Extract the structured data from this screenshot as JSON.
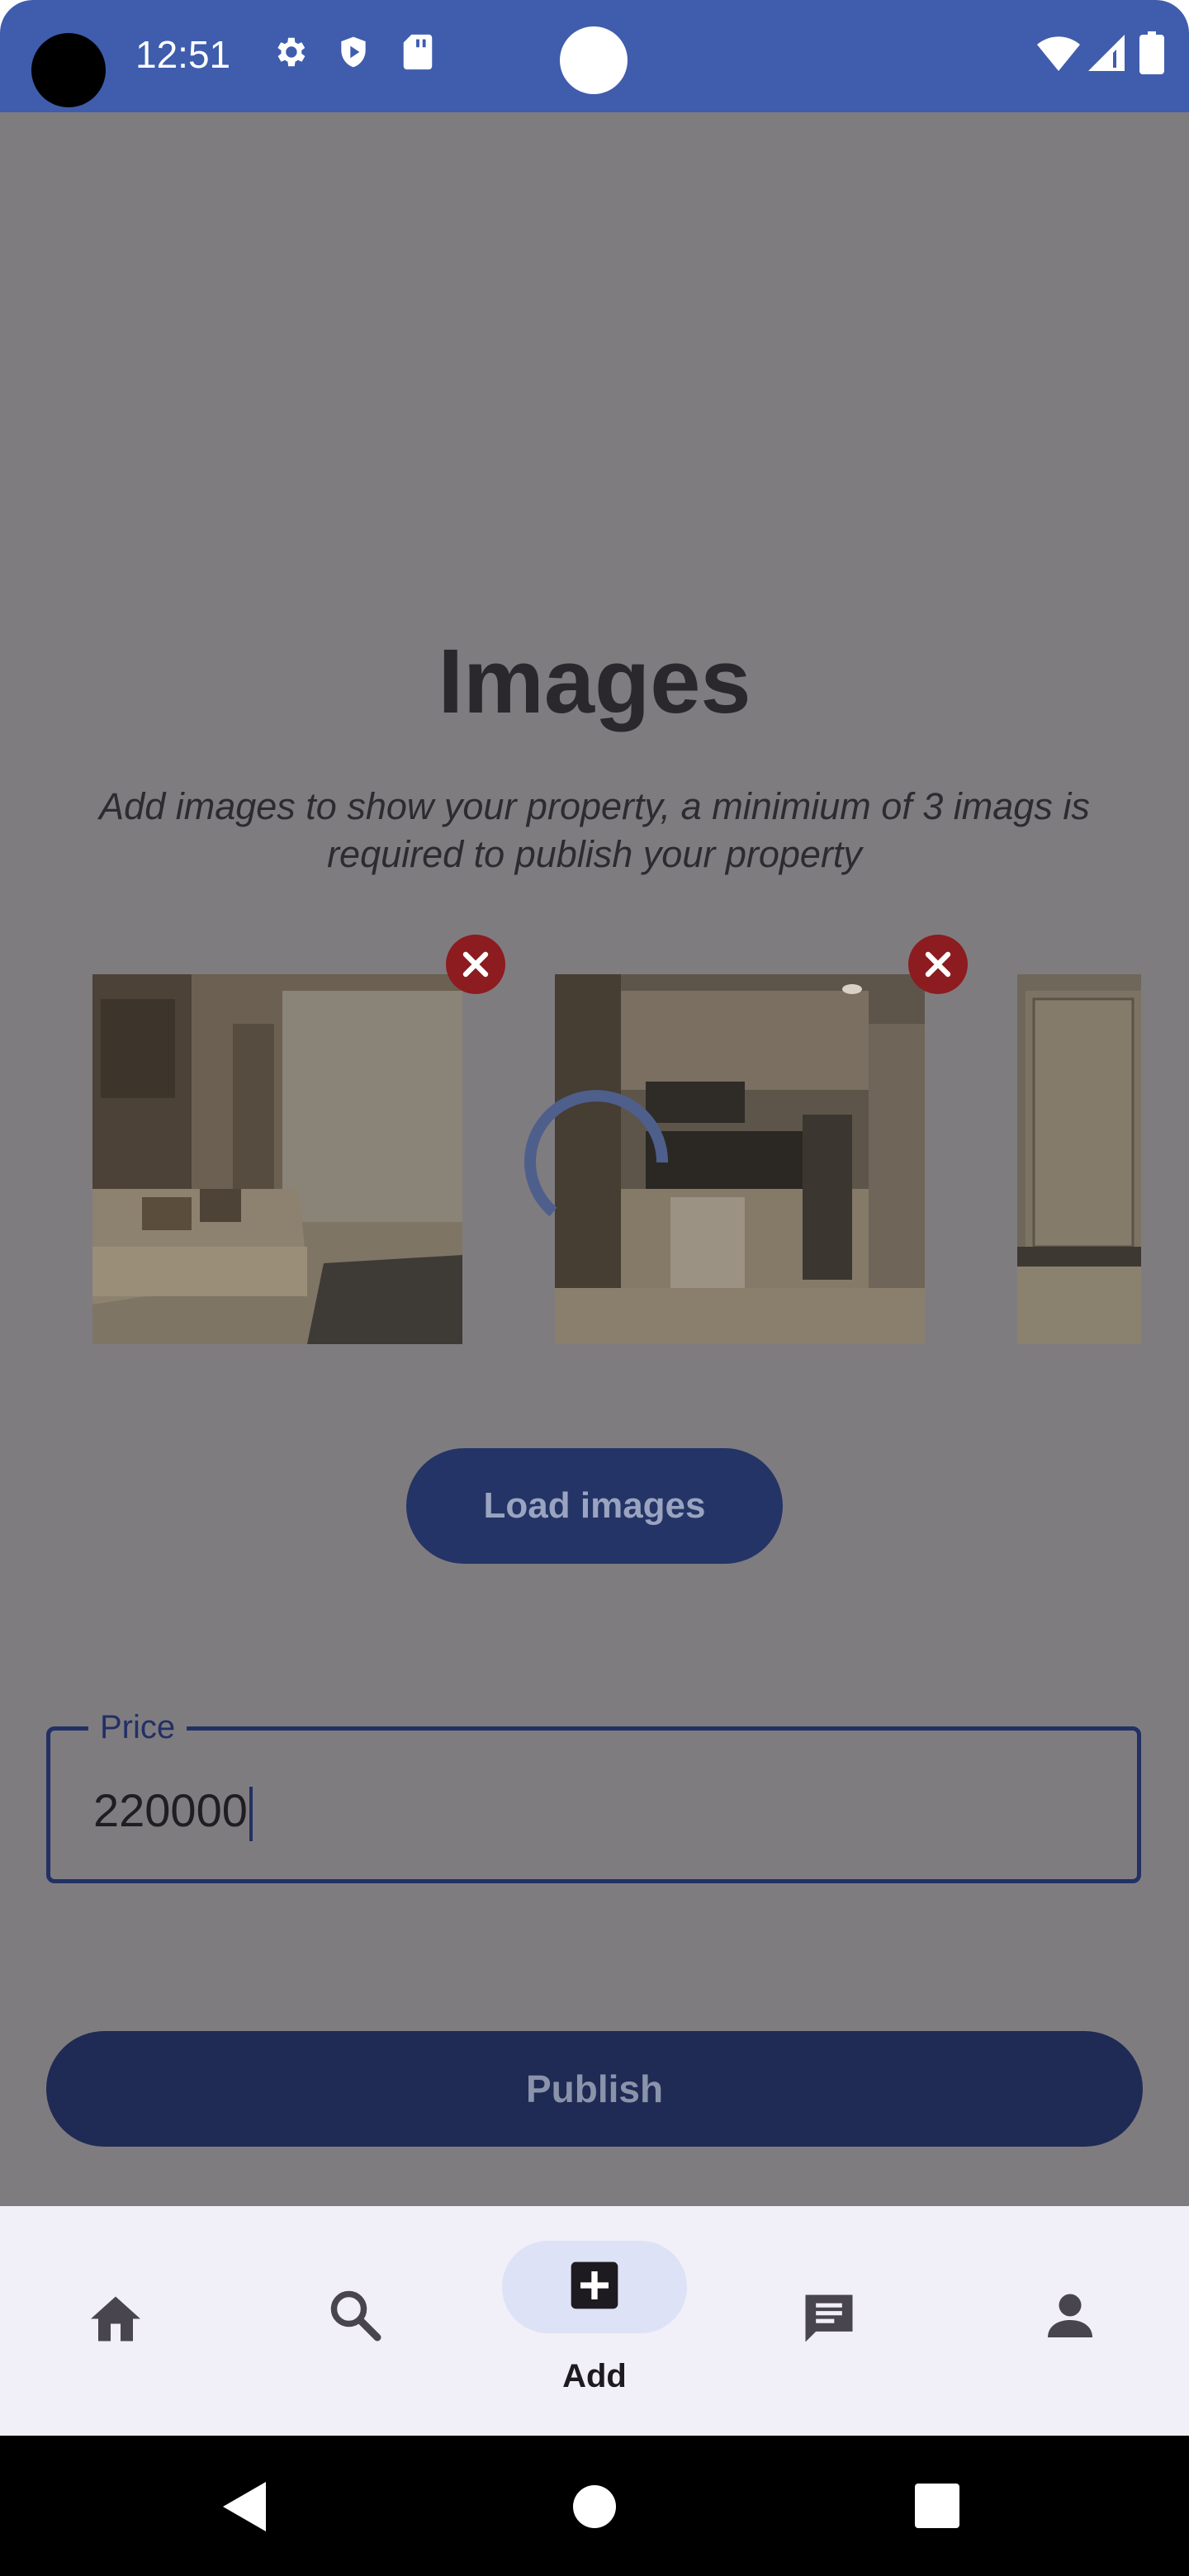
{
  "status_bar": {
    "time": "12:51",
    "icons": [
      "gear-icon",
      "shield-icon",
      "sd-card-icon",
      "wifi-icon",
      "signal-icon",
      "battery-icon"
    ]
  },
  "page": {
    "title": "Images",
    "subtitle": "Add images to show your property, a minimium of 3 imags is required to publish your property"
  },
  "images": [
    {
      "name": "living-room-photo",
      "removable": true
    },
    {
      "name": "kitchen-photo",
      "removable": true
    },
    {
      "name": "door-photo",
      "removable": false
    }
  ],
  "load_images_button": "Load images",
  "price": {
    "label": "Price",
    "value": "220000"
  },
  "publish_button": "Publish",
  "bottom_nav": {
    "items": [
      {
        "icon": "home-icon",
        "label": ""
      },
      {
        "icon": "search-icon",
        "label": ""
      },
      {
        "icon": "add-icon",
        "label": "Add",
        "selected": true
      },
      {
        "icon": "chat-icon",
        "label": ""
      },
      {
        "icon": "profile-icon",
        "label": ""
      }
    ]
  },
  "colors": {
    "status_bar": "#3f5dac",
    "overlay": "#7f7c80",
    "primary_button": "#243466",
    "remove_button": "#8c1c1f",
    "nav_background": "#f1eff7",
    "nav_pill": "#dde2f6"
  }
}
